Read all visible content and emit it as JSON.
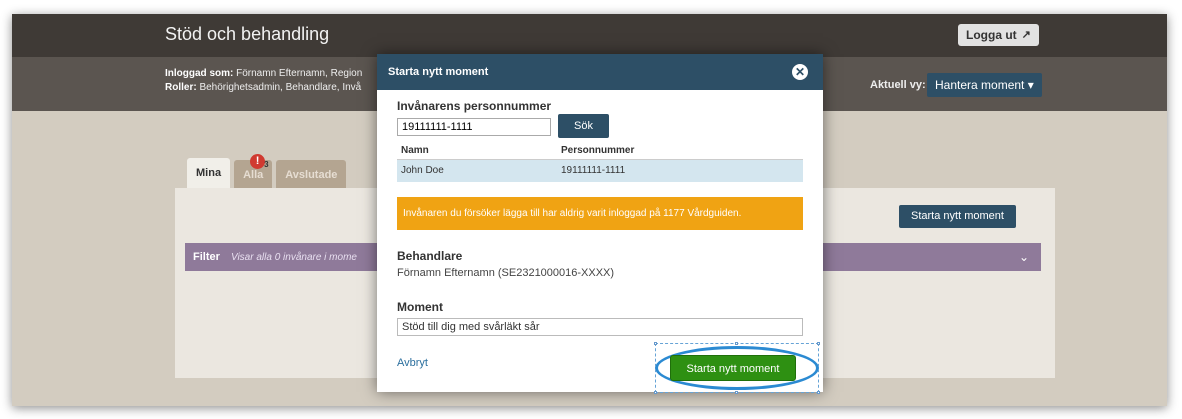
{
  "header": {
    "title": "Stöd och behandling",
    "logout_label": "Logga ut",
    "logout_icon": "logout-icon"
  },
  "userbar": {
    "logged_in_label": "Inloggad som:",
    "logged_in_value": "Förnamn Efternamn, Region",
    "roles_label": "Roller:",
    "roles_value": "Behörighetsadmin, Behandlare, Invå",
    "view_label": "Aktuell vy:",
    "view_value": "Hantera moment ▾"
  },
  "tabs": [
    {
      "label": "Mina"
    },
    {
      "label": "Alla",
      "badge": "!",
      "count": "3"
    },
    {
      "label": "Avslutade"
    }
  ],
  "panel": {
    "start_button_label": "Starta nytt moment",
    "filter_label": "Filter",
    "filter_text": "Visar alla 0 invånare i mome"
  },
  "modal": {
    "title": "Starta nytt moment",
    "pn_label": "Invånarens personnummer",
    "pn_value": "19111111-1111",
    "search_label": "Sök",
    "col_name": "Namn",
    "col_pn": "Personnummer",
    "row_name": "John Doe",
    "row_pn": "19111111-1111",
    "warning": "Invånaren du försöker lägga till har aldrig varit inloggad på 1177 Vårdguiden.",
    "behandlare_label": "Behandlare",
    "behandlare_value": "Förnamn Efternamn (SE2321000016-XXXX)",
    "moment_label": "Moment",
    "moment_value": "Stöd till dig med svårläkt sår",
    "cancel_label": "Avbryt",
    "start_label": "Starta nytt moment"
  },
  "colors": {
    "header_bg": "#3f3a36",
    "modal_header": "#2d4f66",
    "warning": "#f0a313",
    "primary_green": "#2e9012",
    "highlight": "#2b8ad2"
  }
}
